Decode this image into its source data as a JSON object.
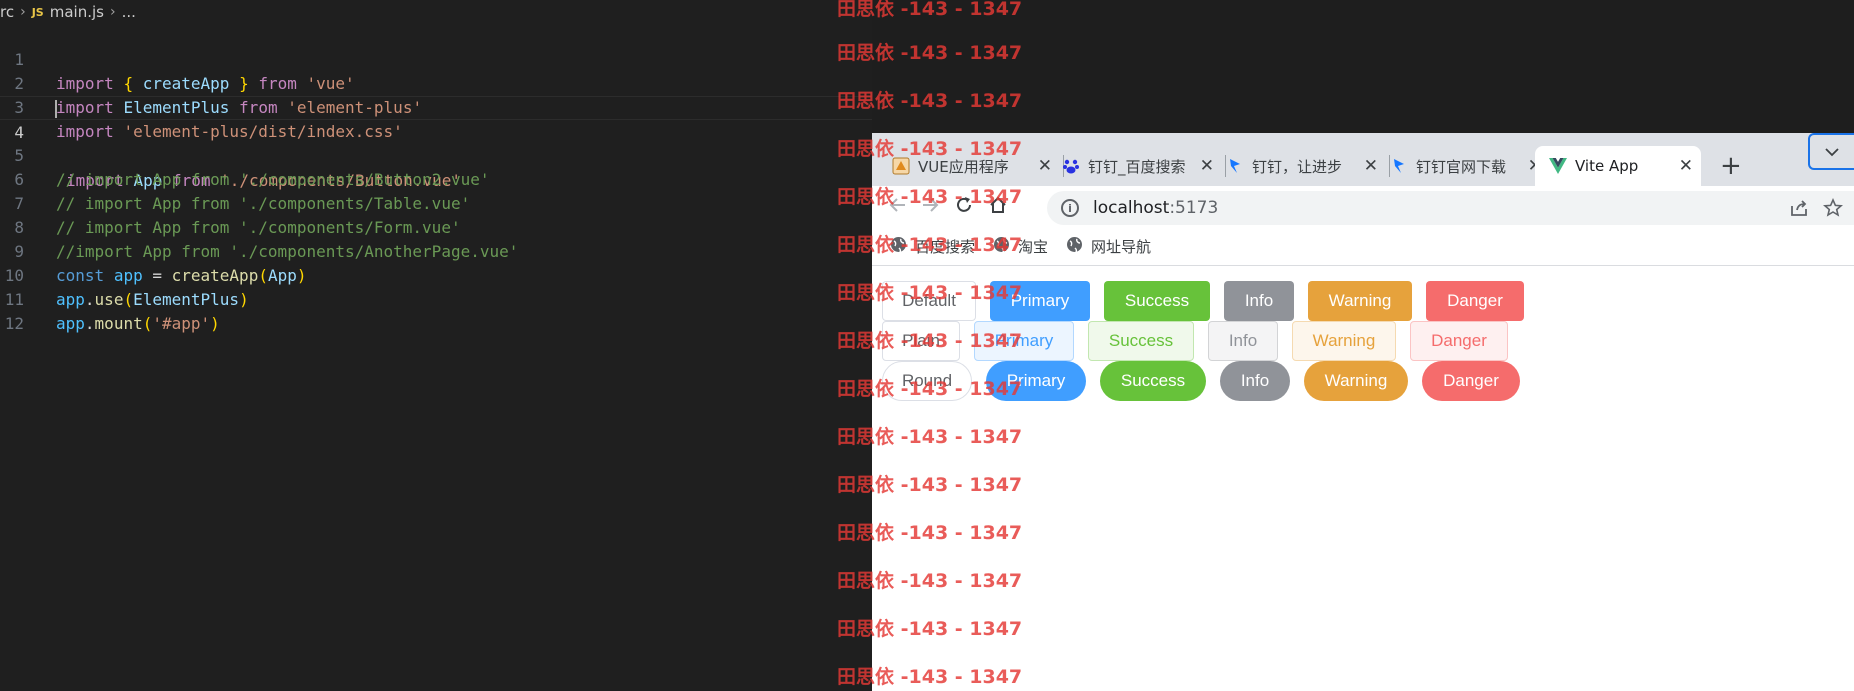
{
  "editor": {
    "breadcrumb": {
      "folder": "rc",
      "file_badge": "JS",
      "file": "main.js",
      "more": "..."
    },
    "active_line": 4,
    "lines": [
      {
        "n": "1"
      },
      {
        "n": "2"
      },
      {
        "n": "3"
      },
      {
        "n": "4"
      },
      {
        "n": "5"
      },
      {
        "n": "6"
      },
      {
        "n": "7"
      },
      {
        "n": "8"
      },
      {
        "n": "9"
      },
      {
        "n": "10"
      },
      {
        "n": "11"
      },
      {
        "n": "12"
      }
    ],
    "code": {
      "l1": {
        "kw1": "import",
        "b1": "{",
        "id": "createApp",
        "b2": "}",
        "kw2": "from",
        "s": "'vue'"
      },
      "l2": {
        "kw1": "import",
        "id": "ElementPlus",
        "kw2": "from",
        "s": "'element-plus'"
      },
      "l3": {
        "kw1": "import",
        "s": "'element-plus/dist/index.css'"
      },
      "l4": {
        "kw1": "import",
        "id": "App",
        "kw2": "from",
        "s": "'./components/Button.vue'"
      },
      "l5": "// import App from './components/Button2.vue'",
      "l6": "// import App from './components/Table.vue'",
      "l7": "// import App from './components/Form.vue'",
      "l8": "//import App from './components/AnotherPage.vue'",
      "l9": {
        "kw": "const",
        "var": "app",
        "eq": " = ",
        "fn": "createApp",
        "p1": "(",
        "arg": "App",
        "p2": ")"
      },
      "l10": {
        "obj": "app",
        "dot": ".",
        "fn": "use",
        "p1": "(",
        "arg": "ElementPlus",
        "p2": ")"
      },
      "l11": {
        "obj": "app",
        "dot": ".",
        "fn": "mount",
        "p1": "(",
        "s": "'#app'",
        "p2": ")"
      }
    }
  },
  "watermark": {
    "text": "田思依 -143 - 1347",
    "color": "#e53935"
  },
  "browser": {
    "tabs": [
      {
        "title": "VUE应用程序",
        "icon": "vue-app-favicon"
      },
      {
        "title": "钉钉_百度搜索",
        "icon": "baidu-favicon"
      },
      {
        "title": "钉钉，让进步",
        "icon": "dingtalk-favicon"
      },
      {
        "title": "钉钉官网下载",
        "icon": "dingtalk-favicon"
      },
      {
        "title": "Vite App",
        "icon": "vue-logo-favicon",
        "active": true
      }
    ],
    "new_tab": "+",
    "address": {
      "host": "localhost",
      "port": ":5173"
    },
    "bookmarks": [
      {
        "label": "百度搜索"
      },
      {
        "label": "淘宝"
      },
      {
        "label": "网址导航"
      }
    ]
  },
  "page": {
    "rows": [
      {
        "type": "normal",
        "buttons": [
          "Default",
          "Primary",
          "Success",
          "Info",
          "Warning",
          "Danger"
        ]
      },
      {
        "type": "plain",
        "buttons": [
          "Plain",
          "Primary",
          "Success",
          "Info",
          "Warning",
          "Danger"
        ]
      },
      {
        "type": "round",
        "buttons": [
          "Round",
          "Primary",
          "Success",
          "Info",
          "Warning",
          "Danger"
        ]
      }
    ]
  },
  "colors": {
    "primary": "#409eff",
    "success": "#67c23a",
    "info": "#909399",
    "warning": "#e6a23c",
    "danger": "#f56c6c"
  }
}
